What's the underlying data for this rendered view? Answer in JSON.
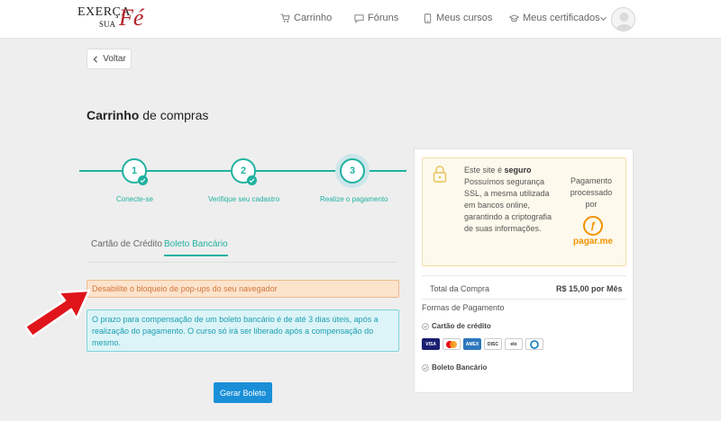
{
  "header": {
    "logo": {
      "line1": "EXERÇA",
      "line2": "SUA",
      "line3": "Fé"
    },
    "nav": [
      {
        "label": "Carrinho",
        "icon": "cart-icon"
      },
      {
        "label": "Fóruns",
        "icon": "chat-bubble-icon"
      },
      {
        "label": "Meus cursos",
        "icon": "tablet-icon"
      },
      {
        "label": "Meus certificados",
        "icon": "graduation-cap-icon"
      }
    ]
  },
  "back": {
    "label": "Voltar"
  },
  "page_title": {
    "bold": "Carrinho",
    "rest": "de compras"
  },
  "steps": [
    {
      "number": "1",
      "label": "Conecte-se",
      "done": true
    },
    {
      "number": "2",
      "label": "Verifique seu cadastro",
      "done": true
    },
    {
      "number": "3",
      "label": "Realize o pagamento",
      "done": false
    }
  ],
  "tabs": [
    {
      "label": "Cartão de Crédito",
      "active": false
    },
    {
      "label": "Boleto Bancário",
      "active": true
    }
  ],
  "alerts": {
    "warning": "Desabilite o bloqueio de pop-ups do seu navegador",
    "info": "O prazo para compensação de um boleto bancário é de até 3 dias úteis, após a realização do pagamento. O curso só irá ser liberado após a compensação do mesmo."
  },
  "generate_button": {
    "label": "Gerar Boleto"
  },
  "security": {
    "prefix": "Este site é ",
    "bold": "seguro",
    "text": "Possuímos segurança SSL, a mesma utilizada em bancos online, garantindo a criptografia de suas informações.",
    "processed_by": "Pagamento processado por",
    "provider": "pagar.me"
  },
  "summary": {
    "total_label": "Total da Compra",
    "total_value": "R$ 15,00 por Mês",
    "methods_label": "Formas de Pagamento",
    "methods": [
      {
        "label": "Cartão de crédito"
      },
      {
        "label": "Boleto Bancário"
      }
    ],
    "cards": [
      "VISA",
      "MC",
      "AMEX",
      "DISCOVER",
      "ELO",
      "DINERS"
    ]
  },
  "colors": {
    "accent": "#20b2a0",
    "primary_button": "#1a8fd8",
    "warning_bg": "#fce3cc",
    "info_bg": "#dcf4f7",
    "arrow": "#e0141b"
  }
}
